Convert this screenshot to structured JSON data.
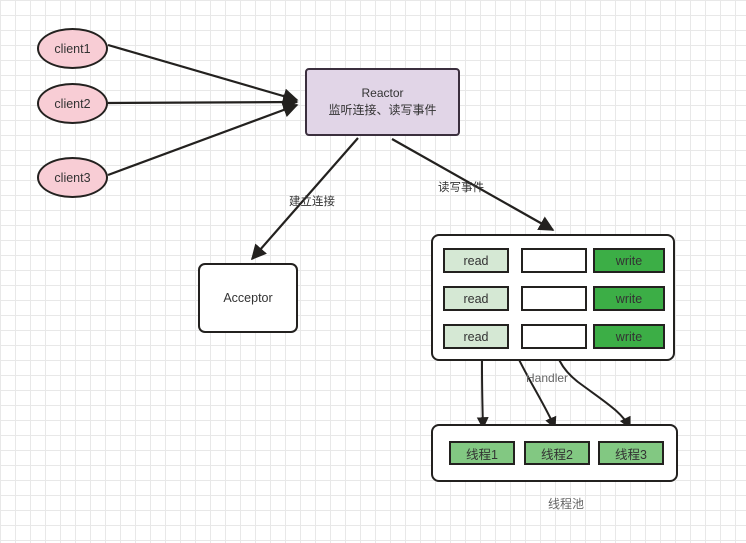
{
  "diagram": {
    "title": "Reactor pattern diagram",
    "colors": {
      "client_fill": "#f8cdd5",
      "reactor_fill": "#e1d5e7",
      "read_fill": "#d5e8d4",
      "write_fill": "#3cae46",
      "thread_fill": "#82c882",
      "stroke": "#23211f",
      "grid": "#e8e8e8"
    },
    "clients": [
      {
        "label": "client1"
      },
      {
        "label": "client2"
      },
      {
        "label": "client3"
      }
    ],
    "reactor": {
      "title": "Reactor",
      "subtitle": "监听连接、读写事件"
    },
    "acceptor": {
      "label": "Acceptor"
    },
    "handler": {
      "caption": "Handler",
      "rows": [
        {
          "read": "read",
          "middle": "",
          "write": "write"
        },
        {
          "read": "read",
          "middle": "",
          "write": "write"
        },
        {
          "read": "read",
          "middle": "",
          "write": "write"
        }
      ]
    },
    "thread_pool": {
      "caption": "线程池",
      "threads": [
        {
          "label": "线程1"
        },
        {
          "label": "线程2"
        },
        {
          "label": "线程3"
        }
      ]
    },
    "edge_labels": {
      "establish_connection": "建立连接",
      "read_write_event": "读写事件"
    }
  }
}
